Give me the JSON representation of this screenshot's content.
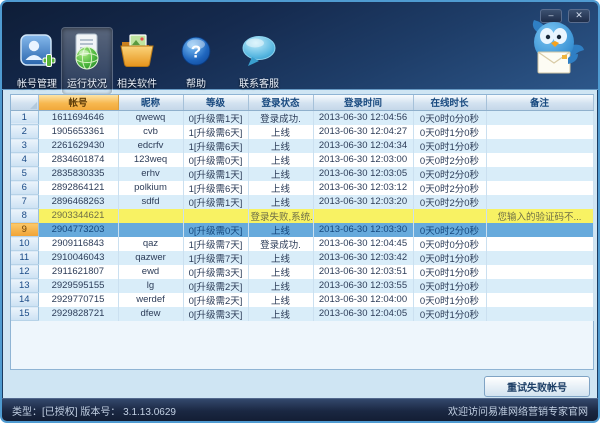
{
  "titlebar": {
    "minimize_label": "–",
    "close_label": "✕"
  },
  "toolbar": {
    "items": [
      {
        "label": "帐号管理",
        "selected": false
      },
      {
        "label": "运行状况",
        "selected": true
      },
      {
        "label": "相关软件",
        "selected": false
      },
      {
        "label": "帮助",
        "selected": false
      },
      {
        "label": "联系客服",
        "selected": false
      }
    ]
  },
  "table": {
    "columns": [
      "",
      "帐号",
      "昵称",
      "等级",
      "登录状态",
      "登录时间",
      "在线时长",
      "备注"
    ],
    "sorted_column": "帐号",
    "rows": [
      {
        "num": "1",
        "account": "1611694646",
        "nickname": "qwewq",
        "level": "0[升级需1天]",
        "status": "登录成功.",
        "login_time": "2013-06-30 12:04:56",
        "online_time": "0天0时0分0秒",
        "remark": "",
        "state": "normal"
      },
      {
        "num": "2",
        "account": "1905653361",
        "nickname": "cvb",
        "level": "1[升级需6天]",
        "status": "上线",
        "login_time": "2013-06-30 12:04:27",
        "online_time": "0天0时1分0秒",
        "remark": "",
        "state": "normal"
      },
      {
        "num": "3",
        "account": "2261629430",
        "nickname": "edcrfv",
        "level": "1[升级需6天]",
        "status": "上线",
        "login_time": "2013-06-30 12:04:34",
        "online_time": "0天0时1分0秒",
        "remark": "",
        "state": "normal"
      },
      {
        "num": "4",
        "account": "2834601874",
        "nickname": "123weq",
        "level": "0[升级需0天]",
        "status": "上线",
        "login_time": "2013-06-30 12:03:00",
        "online_time": "0天0时2分0秒",
        "remark": "",
        "state": "normal"
      },
      {
        "num": "5",
        "account": "2835830335",
        "nickname": "erhv",
        "level": "0[升级需1天]",
        "status": "上线",
        "login_time": "2013-06-30 12:03:05",
        "online_time": "0天0时2分0秒",
        "remark": "",
        "state": "normal"
      },
      {
        "num": "6",
        "account": "2892864121",
        "nickname": "polkium",
        "level": "1[升级需6天]",
        "status": "上线",
        "login_time": "2013-06-30 12:03:12",
        "online_time": "0天0时2分0秒",
        "remark": "",
        "state": "normal"
      },
      {
        "num": "7",
        "account": "2896468263",
        "nickname": "sdfd",
        "level": "0[升级需1天]",
        "status": "上线",
        "login_time": "2013-06-30 12:03:20",
        "online_time": "0天0时2分0秒",
        "remark": "",
        "state": "normal"
      },
      {
        "num": "8",
        "account": "2903344621",
        "nickname": "",
        "level": "",
        "status": "登录失败,系统...",
        "login_time": "",
        "online_time": "",
        "remark": "您输入的验证码不...",
        "state": "failed"
      },
      {
        "num": "9",
        "account": "2904773203",
        "nickname": "",
        "level": "0[升级需0天]",
        "status": "上线",
        "login_time": "2013-06-30 12:03:30",
        "online_time": "0天0时2分0秒",
        "remark": "",
        "state": "selected"
      },
      {
        "num": "10",
        "account": "2909116843",
        "nickname": "qaz",
        "level": "1[升级需7天]",
        "status": "登录成功.",
        "login_time": "2013-06-30 12:04:45",
        "online_time": "0天0时0分0秒",
        "remark": "",
        "state": "normal"
      },
      {
        "num": "11",
        "account": "2910046043",
        "nickname": "qazwer",
        "level": "1[升级需7天]",
        "status": "上线",
        "login_time": "2013-06-30 12:03:42",
        "online_time": "0天0时1分0秒",
        "remark": "",
        "state": "normal"
      },
      {
        "num": "12",
        "account": "2911621807",
        "nickname": "ewd",
        "level": "0[升级需3天]",
        "status": "上线",
        "login_time": "2013-06-30 12:03:51",
        "online_time": "0天0时1分0秒",
        "remark": "",
        "state": "normal"
      },
      {
        "num": "13",
        "account": "2929595155",
        "nickname": "lg",
        "level": "0[升级需2天]",
        "status": "上线",
        "login_time": "2013-06-30 12:03:55",
        "online_time": "0天0时1分0秒",
        "remark": "",
        "state": "normal"
      },
      {
        "num": "14",
        "account": "2929770715",
        "nickname": "werdef",
        "level": "0[升级需2天]",
        "status": "上线",
        "login_time": "2013-06-30 12:04:00",
        "online_time": "0天0时1分0秒",
        "remark": "",
        "state": "normal"
      },
      {
        "num": "15",
        "account": "2929828721",
        "nickname": "dfew",
        "level": "0[升级需3天]",
        "status": "上线",
        "login_time": "2013-06-30 12:04:05",
        "online_time": "0天0时1分0秒",
        "remark": "",
        "state": "normal"
      }
    ]
  },
  "buttons": {
    "retry_failed": "重试失败帐号"
  },
  "statusbar": {
    "left": "类型：[已授权]  版本号：  3.1.13.0629",
    "right": "欢迎访问易准网络营销专家官网"
  },
  "colors": {
    "sorted_header": "#f1a83a",
    "selected_row": "#67aadc",
    "failed_row": "#f8f263",
    "toolbar_bg": "#152a4e",
    "status_text": "#c3d1e4"
  }
}
